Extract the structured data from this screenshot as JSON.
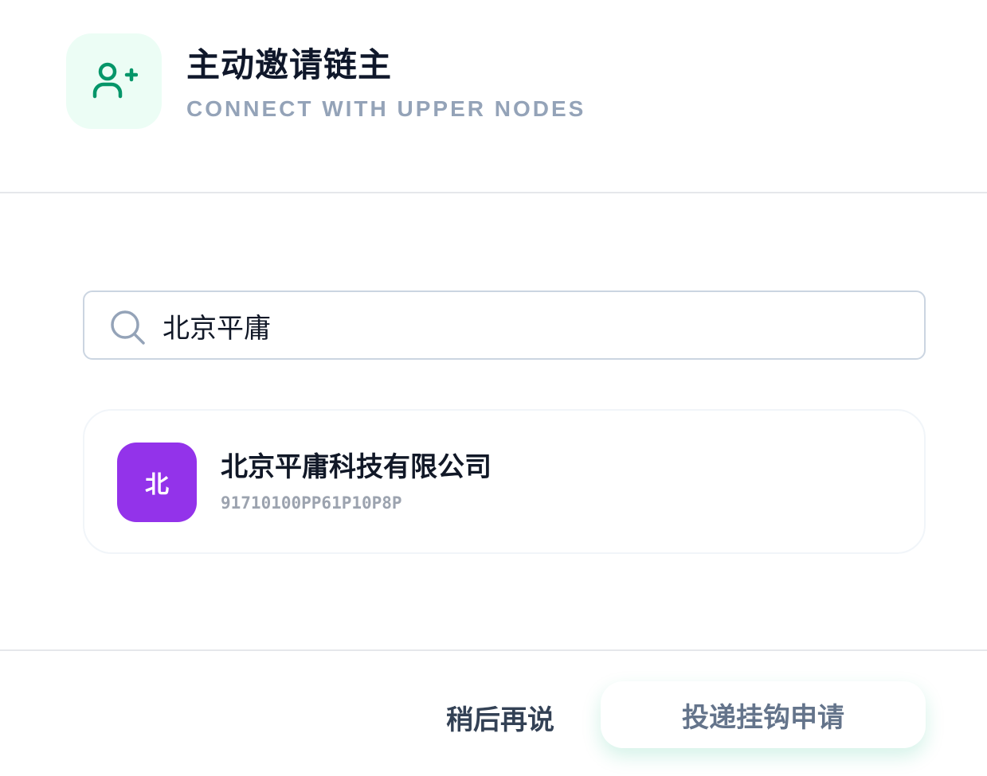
{
  "header": {
    "icon": "user-plus-icon",
    "title": "主动邀请链主",
    "subtitle": "CONNECT WITH UPPER NODES"
  },
  "search": {
    "icon": "search-icon",
    "value": "北京平庸"
  },
  "results": [
    {
      "avatar_letter": "北",
      "avatar_color": "#9333ea",
      "name": "北京平庸科技有限公司",
      "code": "91710100PP61P10P8P"
    }
  ],
  "footer": {
    "later_label": "稍后再说",
    "submit_label": "投递挂钩申请"
  },
  "colors": {
    "accent_green": "#059669",
    "icon_bg": "#ecfdf5"
  }
}
